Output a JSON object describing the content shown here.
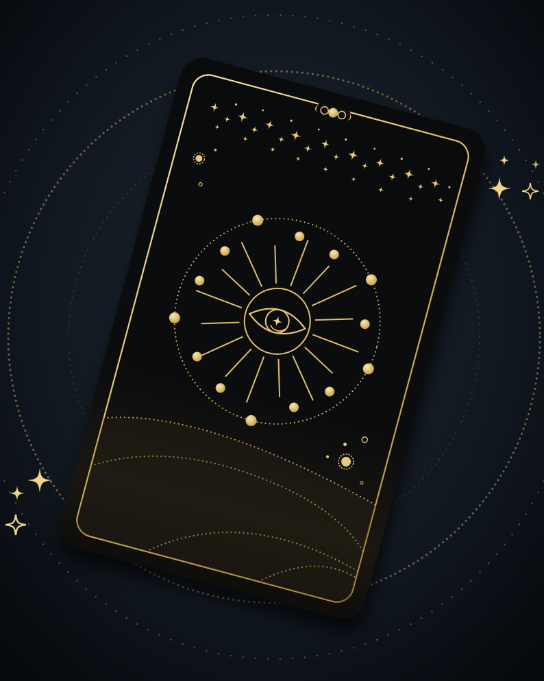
{
  "scene": {
    "description_label": "",
    "colors": {
      "background_center": "#1a222c",
      "background_edge": "#06090d",
      "card_fill_top": "#0a0b0d",
      "card_fill_bottom": "#1b1813",
      "gold": "#e3c36f",
      "gold_light": "#f7e2a3",
      "gold_dark": "#a8873f"
    },
    "icons": {
      "card": "tarot-card-icon",
      "eye": "all-seeing-eye-icon",
      "moon_phases": "moon-phases-icon",
      "sparkles": "four-point-star-icon",
      "sun": "sun-icon",
      "wheel": "zodiac-wheel-icon",
      "hills": "dotted-hills-icon"
    },
    "wheel": {
      "outer_dots": 14,
      "rays": 16
    }
  }
}
